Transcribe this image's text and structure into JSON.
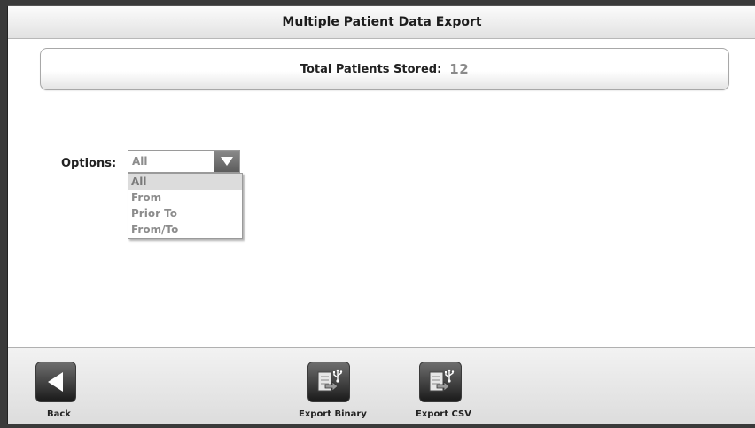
{
  "window": {
    "title": "Multiple Patient Data Export"
  },
  "summary": {
    "label": "Total Patients Stored:",
    "value": "12"
  },
  "options": {
    "label": "Options:",
    "selected": "All",
    "list": [
      "All",
      "From",
      "Prior To",
      "From/To"
    ]
  },
  "footer": {
    "back_label": "Back",
    "export_binary_label": "Export Binary",
    "export_csv_label": "Export CSV"
  },
  "icons": {
    "dropdown": "chevron-down-icon",
    "back": "back-arrow-icon",
    "export": "document-usb-icon"
  },
  "colors": {
    "button_dark": "#3a3a3a",
    "value_gray": "#8a8a8a",
    "selected_option_bg": "#dcdcdc"
  }
}
